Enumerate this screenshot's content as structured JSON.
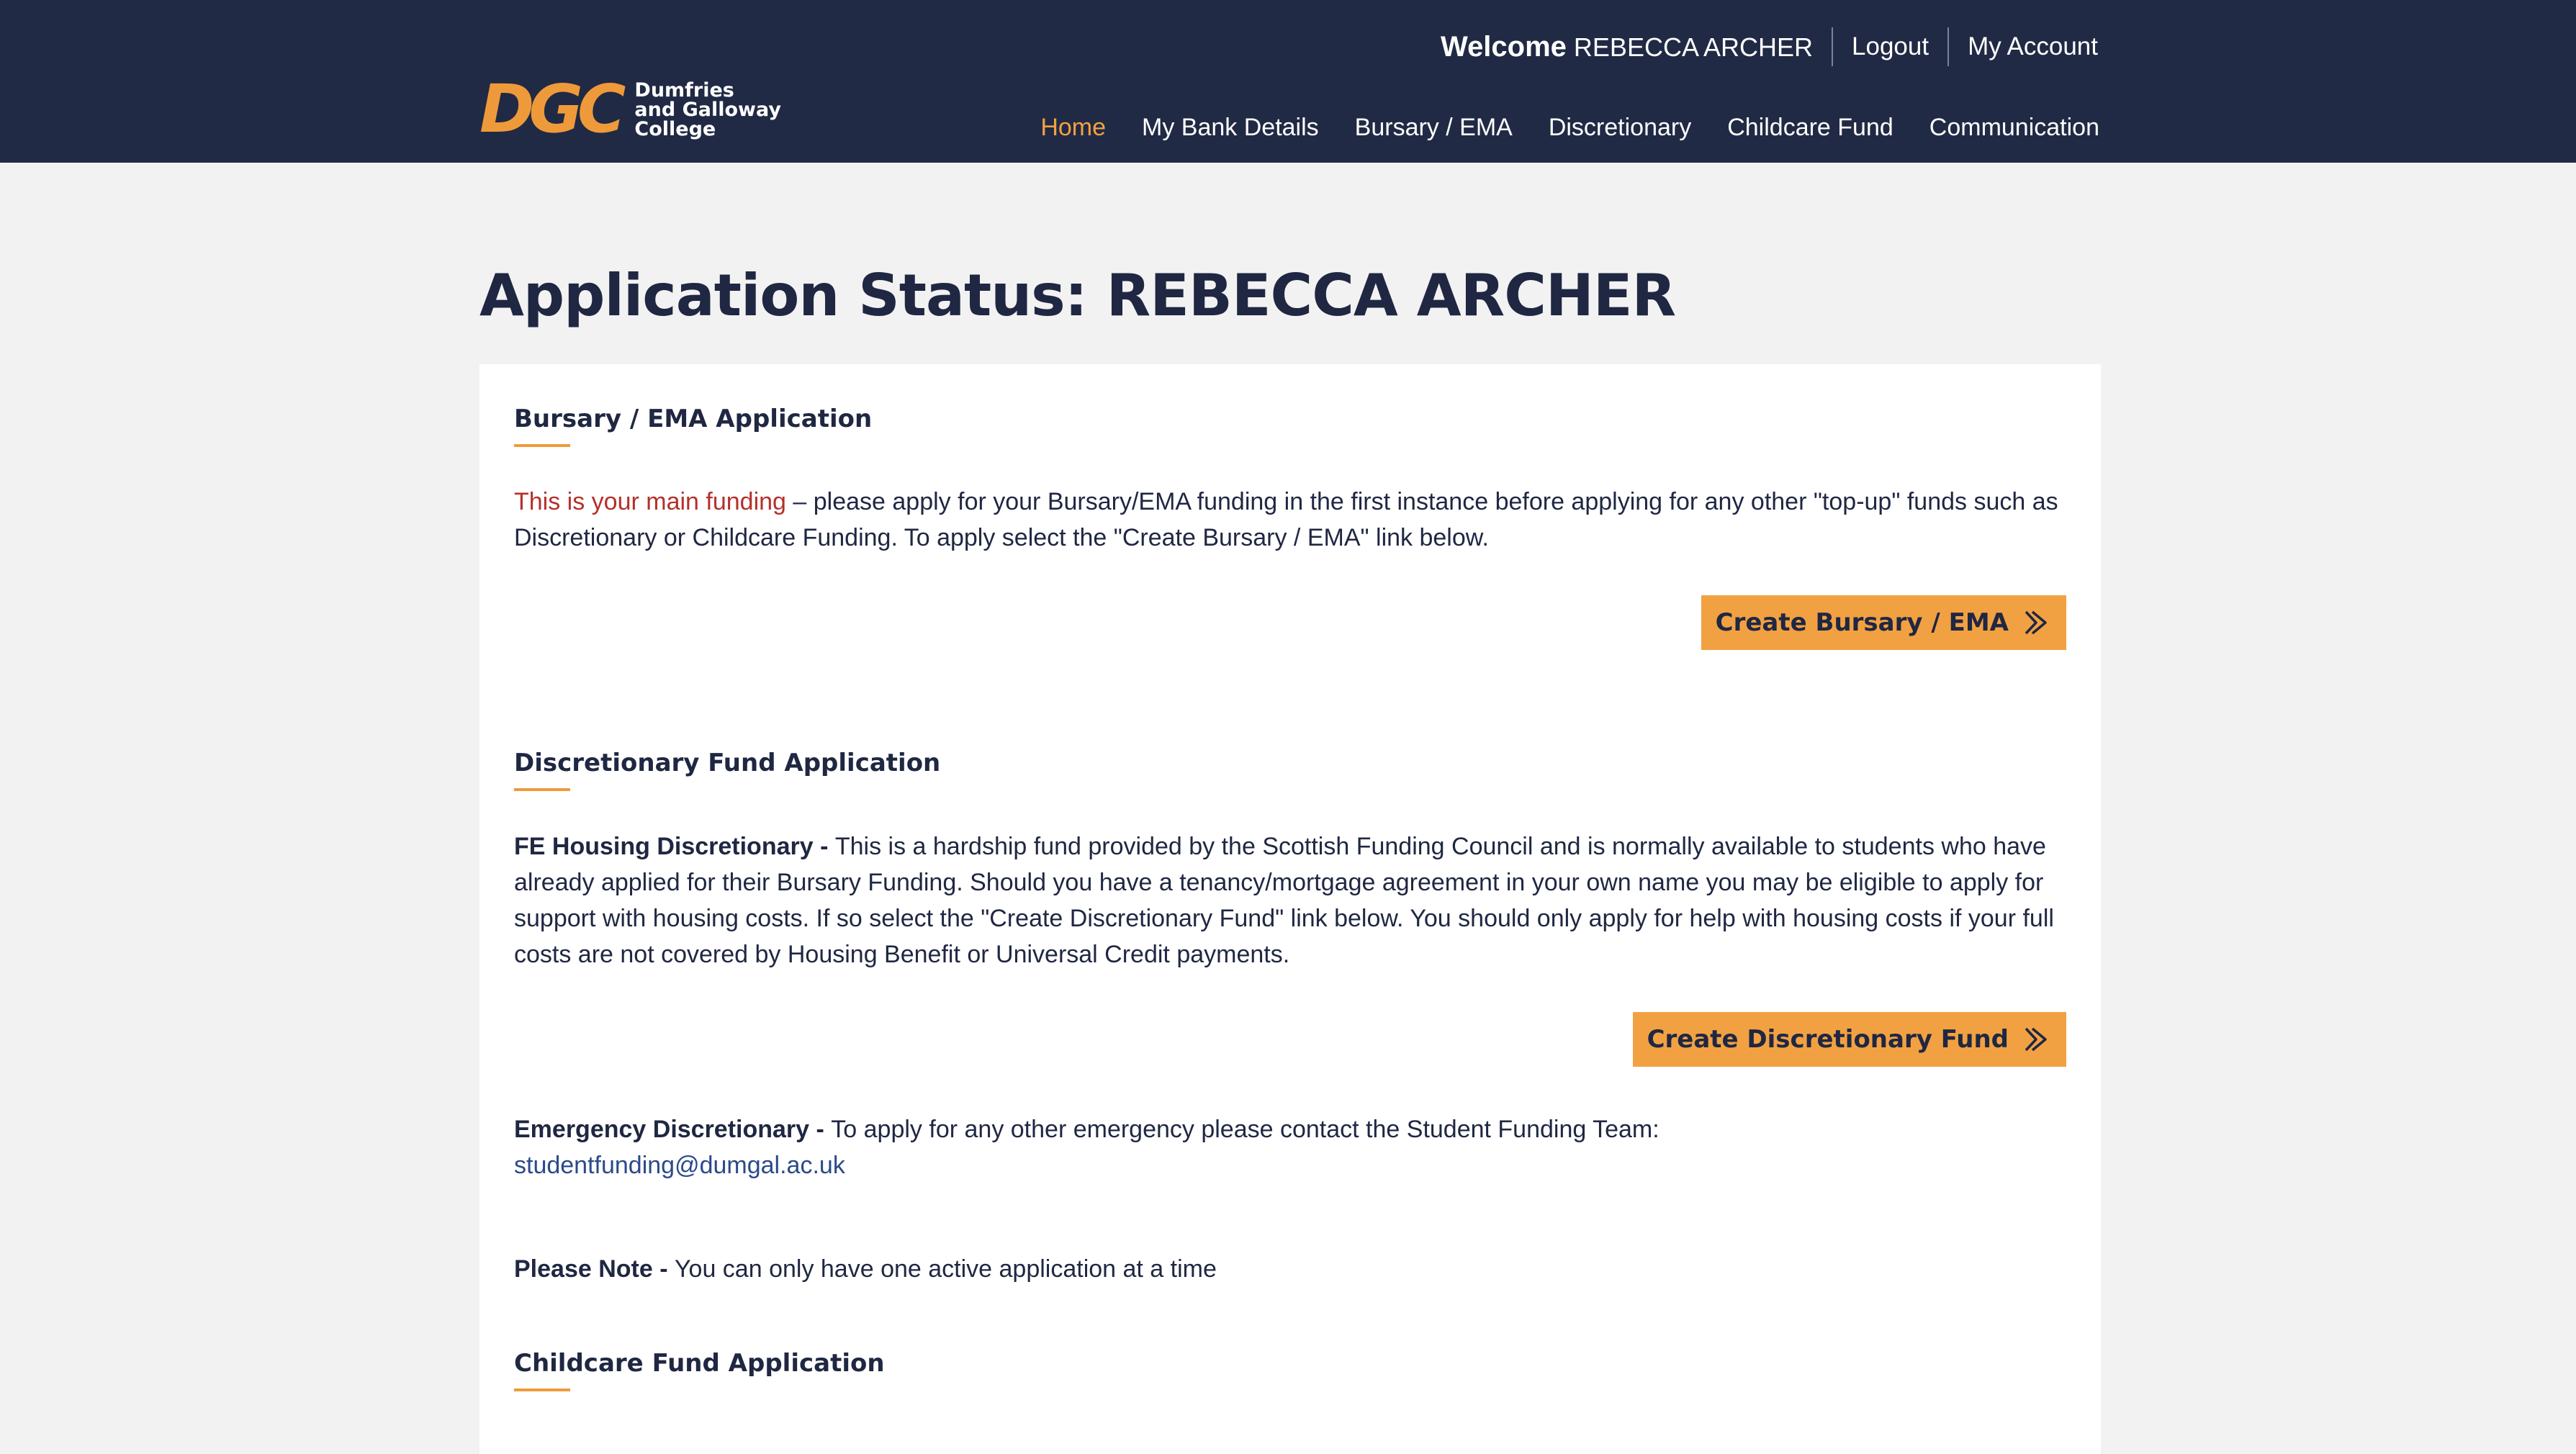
{
  "header": {
    "logo": {
      "mark": "DGC",
      "line1": "Dumfries",
      "line2": "and Galloway",
      "line3": "College"
    },
    "welcome_label": "Welcome",
    "user_name": "REBECCA ARCHER",
    "logout_label": "Logout",
    "account_label": "My Account",
    "nav": [
      {
        "label": "Home",
        "active": true
      },
      {
        "label": "My Bank Details"
      },
      {
        "label": "Bursary / EMA"
      },
      {
        "label": "Discretionary"
      },
      {
        "label": "Childcare Fund"
      },
      {
        "label": "Communication"
      }
    ]
  },
  "page": {
    "title": "Application Status: REBECCA ARCHER"
  },
  "bursary": {
    "title": "Bursary / EMA Application",
    "highlight": "This is your main funding",
    "text": " – please apply for your Bursary/EMA funding in the first instance before applying for any other \"top-up\" funds such as Discretionary or Childcare Funding. To apply select the \"Create Bursary / EMA\" link below.",
    "button": "Create Bursary / EMA"
  },
  "discretionary": {
    "title": "Discretionary Fund Application",
    "housing_label": "FE Housing Discretionary - ",
    "housing_text": "This is a hardship fund provided by the Scottish Funding Council and is normally available to students who have already applied for their Bursary Funding. Should you have a tenancy/mortgage agreement in your own name you may be eligible to apply for support with housing costs. If so select the \"Create Discretionary Fund\" link below. You should only apply for help with housing costs if your full costs are not covered by Housing Benefit or Universal Credit payments.",
    "button": "Create Discretionary Fund",
    "emergency_label": "Emergency Discretionary - ",
    "emergency_text": "To apply for any other emergency please contact the Student Funding Team:",
    "email": "studentfunding@dumgal.ac.uk",
    "note_label": "Please Note - ",
    "note_text": "You can only have one active application at a time"
  },
  "childcare": {
    "title": "Childcare Fund Application"
  },
  "colors": {
    "header_bg": "#212a44",
    "accent": "#f2a142",
    "highlight_red": "#b5302a",
    "link": "#2b4a8a"
  }
}
